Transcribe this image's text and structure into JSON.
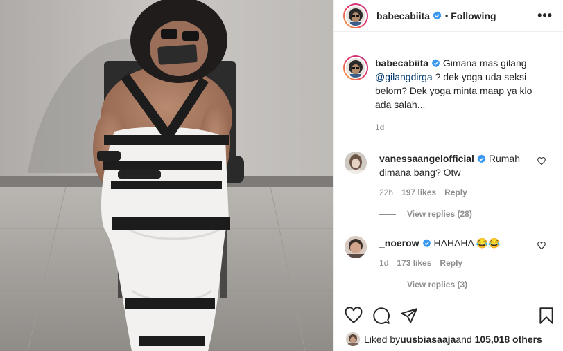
{
  "post": {
    "username": "babecabiita",
    "separator": "•",
    "follow_status": "Following",
    "more_icon": "more-horizontal-icon"
  },
  "caption": {
    "username": "babecabiita",
    "text_before": " Gimana mas gilang ",
    "mention": "@gilangdirga",
    "text_after": " ? dek yoga uda seksi belom? Dek yoga minta maap ya klo ada salah...",
    "time": "1d"
  },
  "comments": [
    {
      "username": "vanessaangelofficial",
      "text": " Rumah dimana bang? Otw",
      "time": "22h",
      "likes": "197 likes",
      "reply": "Reply",
      "view_replies": "View replies (28)"
    },
    {
      "username": "_noerow",
      "text": " HAHAHA 😂😂",
      "time": "1d",
      "likes": "173 likes",
      "reply": "Reply",
      "view_replies": "View replies (3)"
    }
  ],
  "liked_by": {
    "prefix": "Liked by ",
    "user": "uusbiasaaja",
    "middle": " and ",
    "count": "105,018 others"
  },
  "colors": {
    "verified": "#3897f0",
    "text": "#262626",
    "secondary": "#8e8e8e",
    "mention": "#00376b",
    "border": "#efefef"
  }
}
